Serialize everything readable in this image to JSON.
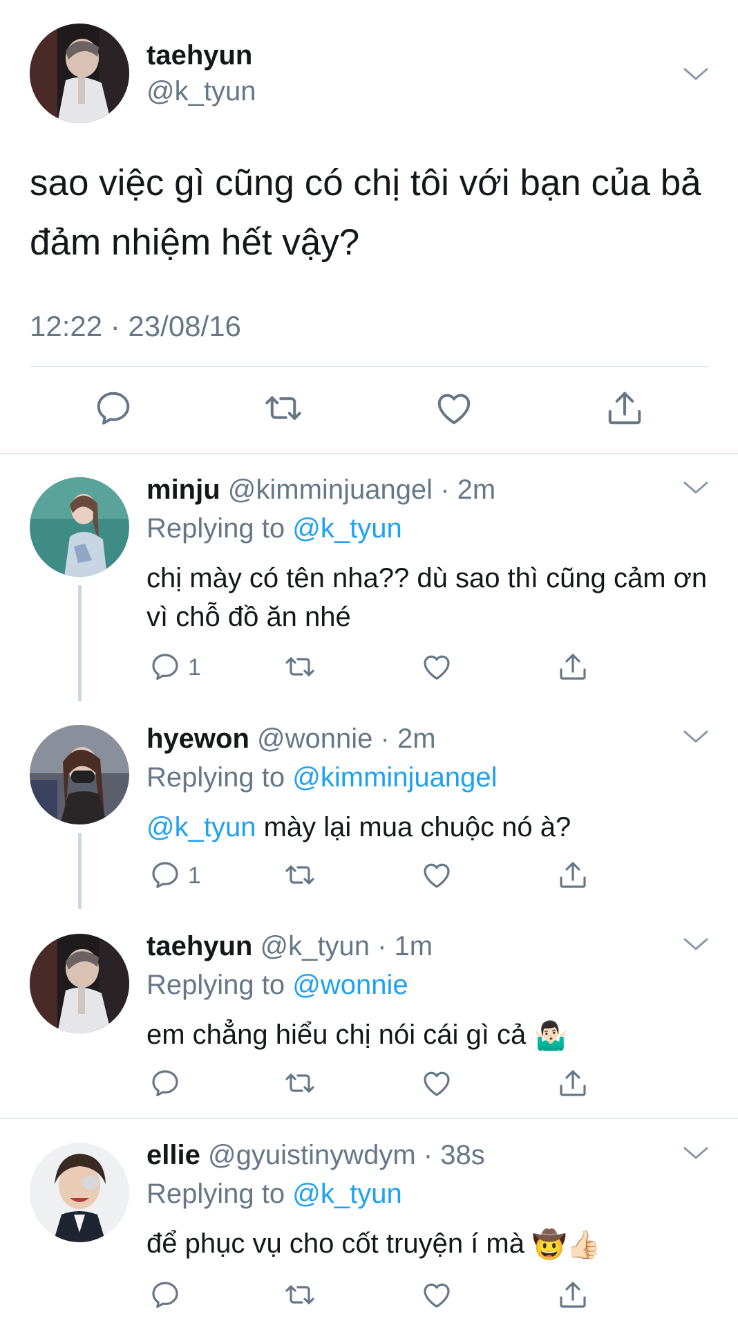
{
  "main_tweet": {
    "name": "taehyun",
    "handle": "@k_tyun",
    "text": "sao việc gì cũng có chị tôi với bạn của bả đảm nhiệm hết vậy?",
    "timestamp": "12:22 · 23/08/16"
  },
  "replies": [
    {
      "name": "minju",
      "handle": "@kimminjuangel",
      "time": "· 2m",
      "replying_label": "Replying to",
      "replying_to": "@k_tyun",
      "text": "chị mày có tên nha?? dù sao thì cũng cảm ơn vì chỗ đồ ăn nhé",
      "reply_count": "1"
    },
    {
      "name": "hyewon",
      "handle": "@wonnie",
      "time": "· 2m",
      "replying_label": "Replying to",
      "replying_to": "@kimminjuangel",
      "text_mention": "@k_tyun",
      "text": "mày lại mua chuộc nó à?",
      "reply_count": "1"
    },
    {
      "name": "taehyun",
      "handle": "@k_tyun",
      "time": "· 1m",
      "replying_label": "Replying to",
      "replying_to": "@wonnie",
      "text": "em chẳng hiểu chị nói cái gì cả",
      "emoji": "🤷🏻‍♂️"
    },
    {
      "name": "ellie",
      "handle": "@gyuistinywdym",
      "time": "· 38s",
      "replying_label": "Replying to",
      "replying_to": "@k_tyun",
      "text": "để phục vụ cho cốt truyện í mà",
      "emoji": "🤠👍🏻"
    }
  ],
  "icons": {
    "reply": "reply-icon",
    "retweet": "retweet-icon",
    "like": "heart-icon",
    "share": "share-icon",
    "caret": "chevron-down-icon"
  },
  "colors": {
    "text": "#14171a",
    "secondary": "#657786",
    "link": "#1da1f2",
    "divider": "#e1e8ed"
  }
}
